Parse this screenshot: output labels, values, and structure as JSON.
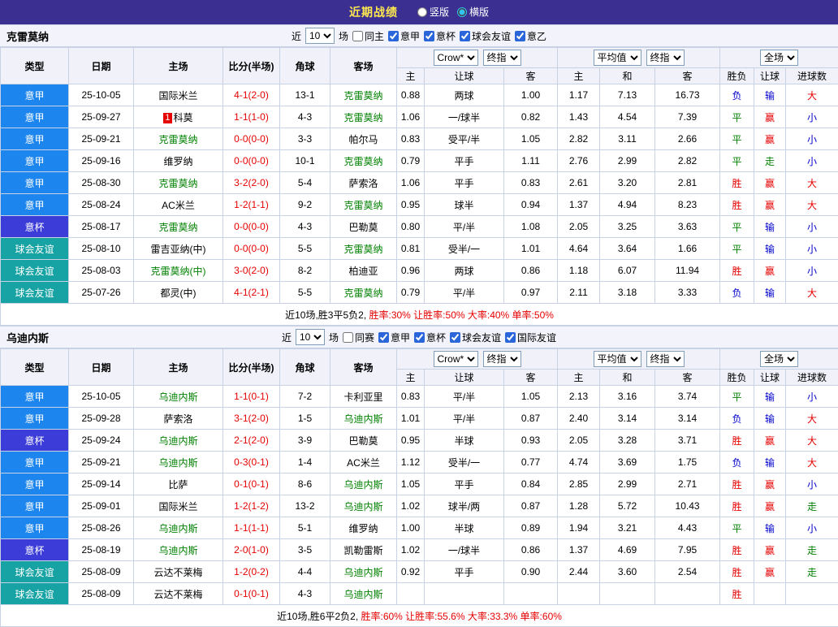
{
  "topbar": {
    "title": "近期战绩",
    "radios": [
      {
        "label": "竖版",
        "selected": false
      },
      {
        "label": "横版",
        "selected": true
      }
    ]
  },
  "colors": {
    "topbar_bg": "#3b2f92",
    "title_color": "#ffe94e",
    "focus_team": "#008000",
    "score": "#e60000",
    "summary_stats": "#e60000",
    "type_bg": {
      "意甲": "#1c86ee",
      "意杯": "#3c3cd9",
      "球会友谊": "#17a3a3"
    },
    "result": {
      "胜": "#e60000",
      "平": "#008000",
      "负": "#0000cc"
    },
    "asia": {
      "赢": "#e60000",
      "输": "#0000cc",
      "走": "#008000"
    },
    "goals": {
      "大": "#e60000",
      "小": "#0000cc",
      "走": "#008000"
    }
  },
  "sections": [
    {
      "team": "克雷莫纳",
      "filter": {
        "near_label": "近",
        "count": "10",
        "games_label": "场",
        "checkboxes": [
          {
            "label": "同主",
            "checked": false
          },
          {
            "label": "意甲",
            "checked": true
          },
          {
            "label": "意杯",
            "checked": true
          },
          {
            "label": "球会友谊",
            "checked": true
          },
          {
            "label": "意乙",
            "checked": true
          }
        ]
      },
      "header": {
        "cols": [
          "类型",
          "日期",
          "主场",
          "比分(半场)",
          "角球",
          "客场"
        ],
        "group1_selects": [
          "Crow*",
          "终指"
        ],
        "group1_cols": [
          "主",
          "让球",
          "客"
        ],
        "group2_selects": [
          "平均值",
          "终指"
        ],
        "group2_cols": [
          "主",
          "和",
          "客"
        ],
        "group3_select": "全场",
        "group3_cols": [
          "胜负",
          "让球",
          "进球数"
        ]
      },
      "rows": [
        {
          "type": "意甲",
          "date": "25-10-05",
          "home": "国际米兰",
          "home_green": false,
          "badge": "",
          "score": "4-1(2-0)",
          "corner": "13-1",
          "away": "克雷莫纳",
          "away_green": true,
          "o1": "0.88",
          "line": "两球",
          "o2": "1.00",
          "a1": "1.17",
          "a2": "7.13",
          "a3": "16.73",
          "res": "负",
          "asia": "输",
          "goals": "大"
        },
        {
          "type": "意甲",
          "date": "25-09-27",
          "home": "科莫",
          "home_green": false,
          "badge": "1",
          "score": "1-1(1-0)",
          "corner": "4-3",
          "away": "克雷莫纳",
          "away_green": true,
          "o1": "1.06",
          "line": "一/球半",
          "o2": "0.82",
          "a1": "1.43",
          "a2": "4.54",
          "a3": "7.39",
          "res": "平",
          "asia": "赢",
          "goals": "小"
        },
        {
          "type": "意甲",
          "date": "25-09-21",
          "home": "克雷莫纳",
          "home_green": true,
          "badge": "",
          "score": "0-0(0-0)",
          "corner": "3-3",
          "away": "帕尔马",
          "away_green": false,
          "o1": "0.83",
          "line": "受平/半",
          "o2": "1.05",
          "a1": "2.82",
          "a2": "3.11",
          "a3": "2.66",
          "res": "平",
          "asia": "赢",
          "goals": "小"
        },
        {
          "type": "意甲",
          "date": "25-09-16",
          "home": "维罗纳",
          "home_green": false,
          "badge": "",
          "score": "0-0(0-0)",
          "corner": "10-1",
          "away": "克雷莫纳",
          "away_green": true,
          "o1": "0.79",
          "line": "平手",
          "o2": "1.11",
          "a1": "2.76",
          "a2": "2.99",
          "a3": "2.82",
          "res": "平",
          "asia": "走",
          "goals": "小"
        },
        {
          "type": "意甲",
          "date": "25-08-30",
          "home": "克雷莫纳",
          "home_green": true,
          "badge": "",
          "score": "3-2(2-0)",
          "corner": "5-4",
          "away": "萨索洛",
          "away_green": false,
          "o1": "1.06",
          "line": "平手",
          "o2": "0.83",
          "a1": "2.61",
          "a2": "3.20",
          "a3": "2.81",
          "res": "胜",
          "asia": "赢",
          "goals": "大"
        },
        {
          "type": "意甲",
          "date": "25-08-24",
          "home": "AC米兰",
          "home_green": false,
          "badge": "",
          "score": "1-2(1-1)",
          "corner": "9-2",
          "away": "克雷莫纳",
          "away_green": true,
          "o1": "0.95",
          "line": "球半",
          "o2": "0.94",
          "a1": "1.37",
          "a2": "4.94",
          "a3": "8.23",
          "res": "胜",
          "asia": "赢",
          "goals": "大"
        },
        {
          "type": "意杯",
          "date": "25-08-17",
          "home": "克雷莫纳",
          "home_green": true,
          "badge": "",
          "score": "0-0(0-0)",
          "corner": "4-3",
          "away": "巴勒莫",
          "away_green": false,
          "o1": "0.80",
          "line": "平/半",
          "o2": "1.08",
          "a1": "2.05",
          "a2": "3.25",
          "a3": "3.63",
          "res": "平",
          "asia": "输",
          "goals": "小"
        },
        {
          "type": "球会友谊",
          "date": "25-08-10",
          "home": "雷吉亚纳(中)",
          "home_green": false,
          "badge": "",
          "score": "0-0(0-0)",
          "corner": "5-5",
          "away": "克雷莫纳",
          "away_green": true,
          "o1": "0.81",
          "line": "受半/一",
          "o2": "1.01",
          "a1": "4.64",
          "a2": "3.64",
          "a3": "1.66",
          "res": "平",
          "asia": "输",
          "goals": "小"
        },
        {
          "type": "球会友谊",
          "date": "25-08-03",
          "home": "克雷莫纳(中)",
          "home_green": true,
          "badge": "",
          "score": "3-0(2-0)",
          "corner": "8-2",
          "away": "柏迪亚",
          "away_green": false,
          "o1": "0.96",
          "line": "两球",
          "o2": "0.86",
          "a1": "1.18",
          "a2": "6.07",
          "a3": "11.94",
          "res": "胜",
          "asia": "赢",
          "goals": "小"
        },
        {
          "type": "球会友谊",
          "date": "25-07-26",
          "home": "都灵(中)",
          "home_green": false,
          "badge": "",
          "score": "4-1(2-1)",
          "corner": "5-5",
          "away": "克雷莫纳",
          "away_green": true,
          "o1": "0.79",
          "line": "平/半",
          "o2": "0.97",
          "a1": "2.11",
          "a2": "3.18",
          "a3": "3.33",
          "res": "负",
          "asia": "输",
          "goals": "大"
        }
      ],
      "summary_prefix": "近10场,胜3平5负2, ",
      "summary_stats": "胜率:30% 让胜率:50% 大率:40% 单率:50%"
    },
    {
      "team": "乌迪内斯",
      "filter": {
        "near_label": "近",
        "count": "10",
        "games_label": "场",
        "checkboxes": [
          {
            "label": "同赛",
            "checked": false
          },
          {
            "label": "意甲",
            "checked": true
          },
          {
            "label": "意杯",
            "checked": true
          },
          {
            "label": "球会友谊",
            "checked": true
          },
          {
            "label": "国际友谊",
            "checked": true
          }
        ]
      },
      "header": {
        "cols": [
          "类型",
          "日期",
          "主场",
          "比分(半场)",
          "角球",
          "客场"
        ],
        "group1_selects": [
          "Crow*",
          "终指"
        ],
        "group1_cols": [
          "主",
          "让球",
          "客"
        ],
        "group2_selects": [
          "平均值",
          "终指"
        ],
        "group2_cols": [
          "主",
          "和",
          "客"
        ],
        "group3_select": "全场",
        "group3_cols": [
          "胜负",
          "让球",
          "进球数"
        ]
      },
      "rows": [
        {
          "type": "意甲",
          "date": "25-10-05",
          "home": "乌迪内斯",
          "home_green": true,
          "badge": "",
          "score": "1-1(0-1)",
          "corner": "7-2",
          "away": "卡利亚里",
          "away_green": false,
          "o1": "0.83",
          "line": "平/半",
          "o2": "1.05",
          "a1": "2.13",
          "a2": "3.16",
          "a3": "3.74",
          "res": "平",
          "asia": "输",
          "goals": "小"
        },
        {
          "type": "意甲",
          "date": "25-09-28",
          "home": "萨索洛",
          "home_green": false,
          "badge": "",
          "score": "3-1(2-0)",
          "corner": "1-5",
          "away": "乌迪内斯",
          "away_green": true,
          "o1": "1.01",
          "line": "平/半",
          "o2": "0.87",
          "a1": "2.40",
          "a2": "3.14",
          "a3": "3.14",
          "res": "负",
          "asia": "输",
          "goals": "大"
        },
        {
          "type": "意杯",
          "date": "25-09-24",
          "home": "乌迪内斯",
          "home_green": true,
          "badge": "",
          "score": "2-1(2-0)",
          "corner": "3-9",
          "away": "巴勒莫",
          "away_green": false,
          "o1": "0.95",
          "line": "半球",
          "o2": "0.93",
          "a1": "2.05",
          "a2": "3.28",
          "a3": "3.71",
          "res": "胜",
          "asia": "赢",
          "goals": "大"
        },
        {
          "type": "意甲",
          "date": "25-09-21",
          "home": "乌迪内斯",
          "home_green": true,
          "badge": "",
          "score": "0-3(0-1)",
          "corner": "1-4",
          "away": "AC米兰",
          "away_green": false,
          "o1": "1.12",
          "line": "受半/一",
          "o2": "0.77",
          "a1": "4.74",
          "a2": "3.69",
          "a3": "1.75",
          "res": "负",
          "asia": "输",
          "goals": "大"
        },
        {
          "type": "意甲",
          "date": "25-09-14",
          "home": "比萨",
          "home_green": false,
          "badge": "",
          "score": "0-1(0-1)",
          "corner": "8-6",
          "away": "乌迪内斯",
          "away_green": true,
          "o1": "1.05",
          "line": "平手",
          "o2": "0.84",
          "a1": "2.85",
          "a2": "2.99",
          "a3": "2.71",
          "res": "胜",
          "asia": "赢",
          "goals": "小"
        },
        {
          "type": "意甲",
          "date": "25-09-01",
          "home": "国际米兰",
          "home_green": false,
          "badge": "",
          "score": "1-2(1-2)",
          "corner": "13-2",
          "away": "乌迪内斯",
          "away_green": true,
          "o1": "1.02",
          "line": "球半/两",
          "o2": "0.87",
          "a1": "1.28",
          "a2": "5.72",
          "a3": "10.43",
          "res": "胜",
          "asia": "赢",
          "goals": "走"
        },
        {
          "type": "意甲",
          "date": "25-08-26",
          "home": "乌迪内斯",
          "home_green": true,
          "badge": "",
          "score": "1-1(1-1)",
          "corner": "5-1",
          "away": "维罗纳",
          "away_green": false,
          "o1": "1.00",
          "line": "半球",
          "o2": "0.89",
          "a1": "1.94",
          "a2": "3.21",
          "a3": "4.43",
          "res": "平",
          "asia": "输",
          "goals": "小"
        },
        {
          "type": "意杯",
          "date": "25-08-19",
          "home": "乌迪内斯",
          "home_green": true,
          "badge": "",
          "score": "2-0(1-0)",
          "corner": "3-5",
          "away": "凯勒雷斯",
          "away_green": false,
          "o1": "1.02",
          "line": "一/球半",
          "o2": "0.86",
          "a1": "1.37",
          "a2": "4.69",
          "a3": "7.95",
          "res": "胜",
          "asia": "赢",
          "goals": "走"
        },
        {
          "type": "球会友谊",
          "date": "25-08-09",
          "home": "云达不莱梅",
          "home_green": false,
          "badge": "",
          "score": "1-2(0-2)",
          "corner": "4-4",
          "away": "乌迪内斯",
          "away_green": true,
          "o1": "0.92",
          "line": "平手",
          "o2": "0.90",
          "a1": "2.44",
          "a2": "3.60",
          "a3": "2.54",
          "res": "胜",
          "asia": "赢",
          "goals": "走"
        },
        {
          "type": "球会友谊",
          "date": "25-08-09",
          "home": "云达不莱梅",
          "home_green": false,
          "badge": "",
          "score": "0-1(0-1)",
          "corner": "4-3",
          "away": "乌迪内斯",
          "away_green": true,
          "o1": "",
          "line": "",
          "o2": "",
          "a1": "",
          "a2": "",
          "a3": "",
          "res": "胜",
          "asia": "",
          "goals": ""
        }
      ],
      "summary_prefix": "近10场,胜6平2负2, ",
      "summary_stats": "胜率:60% 让胜率:55.6% 大率:33.3% 单率:60%"
    }
  ]
}
